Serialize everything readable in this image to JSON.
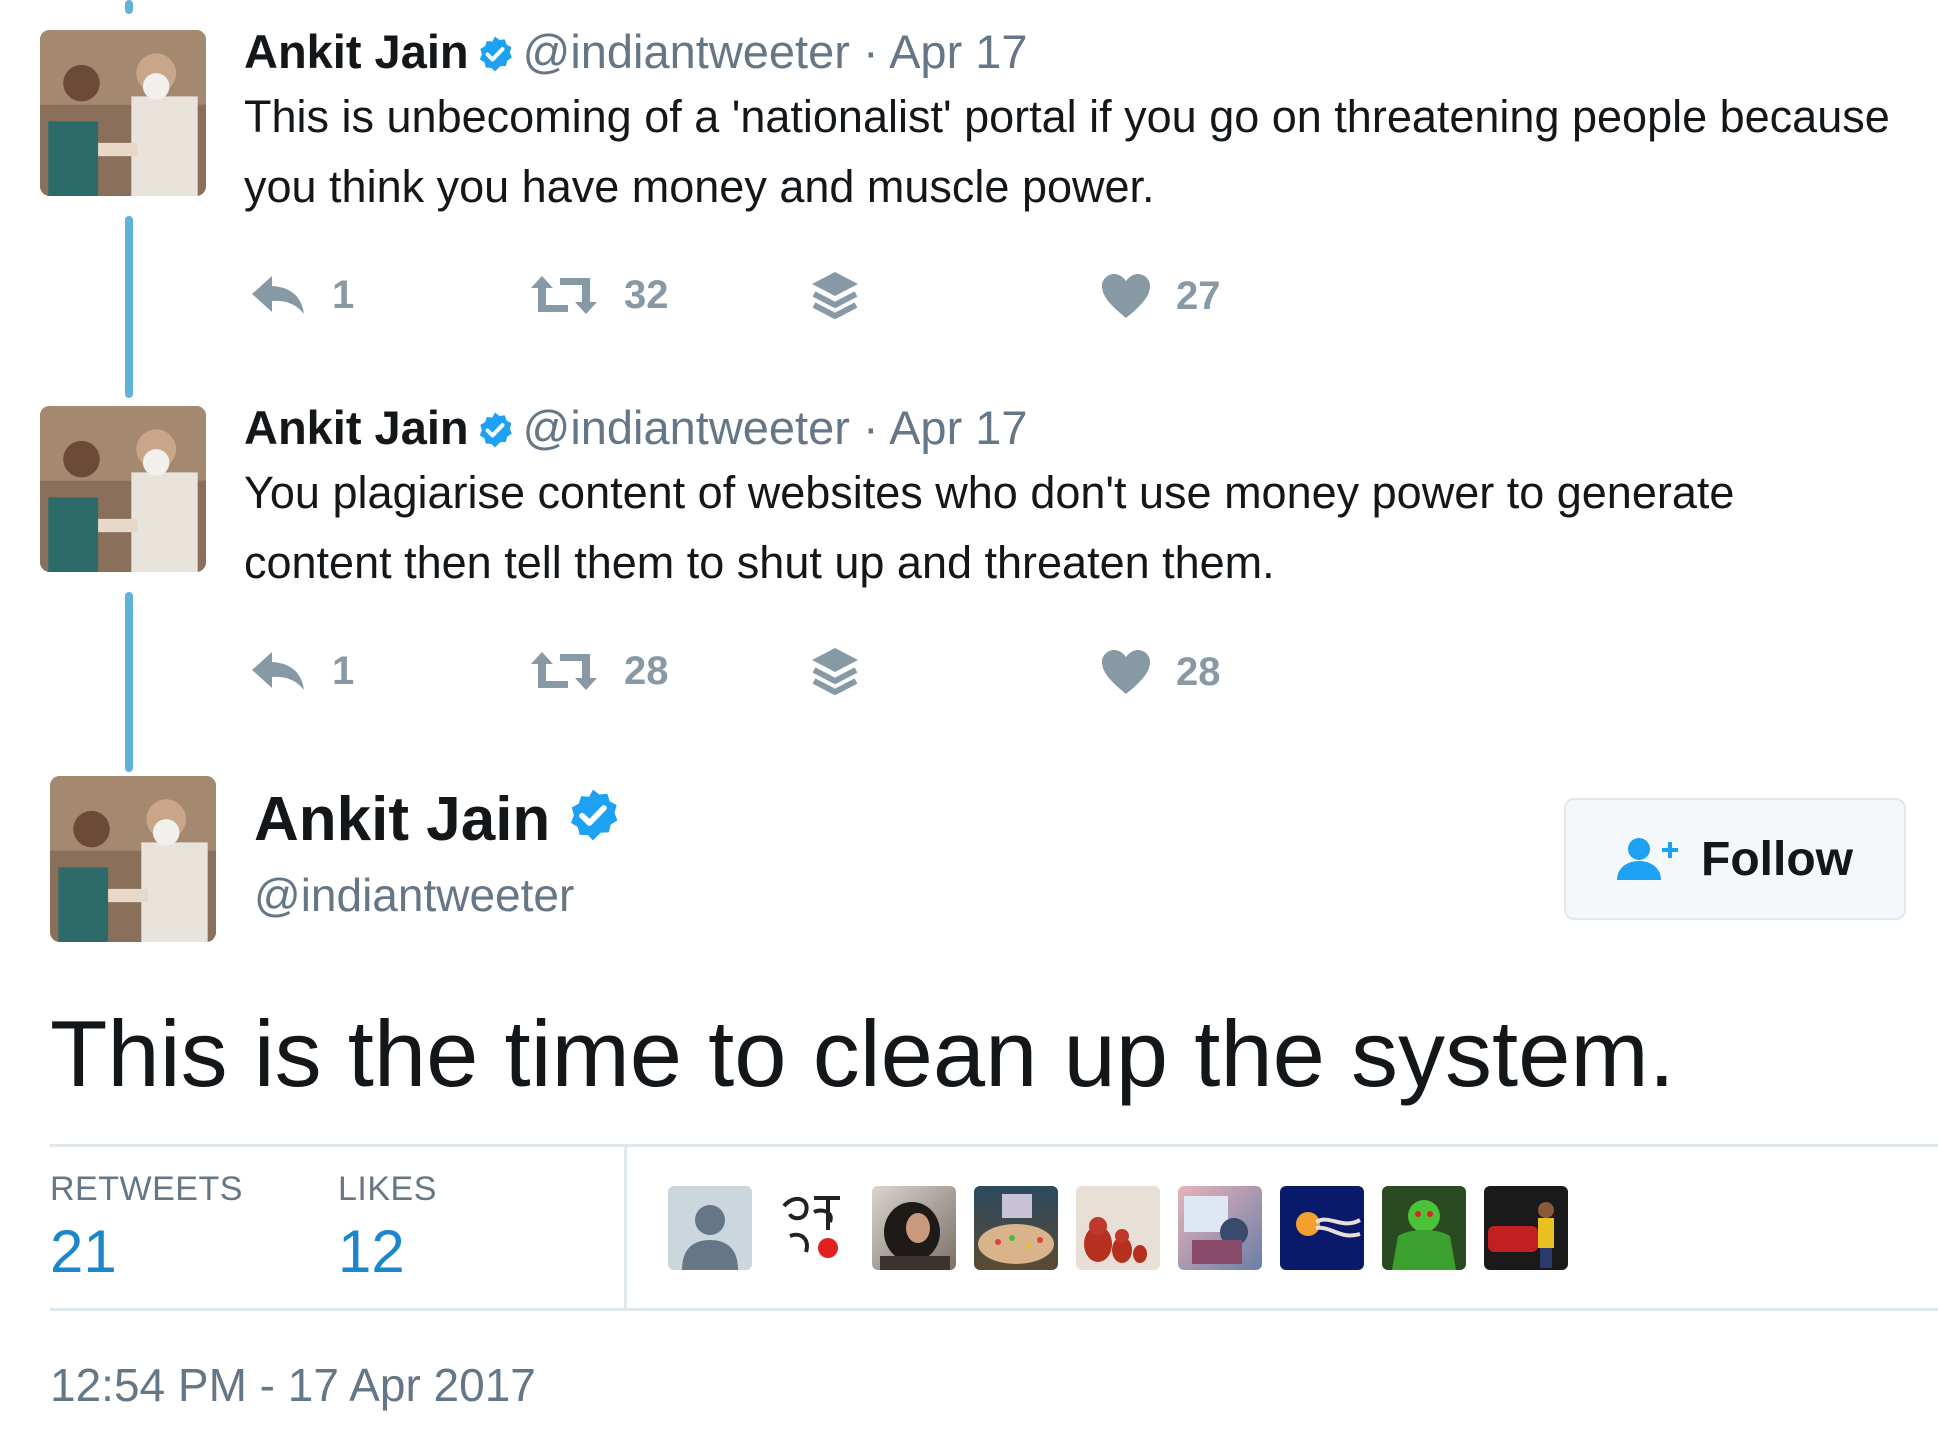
{
  "tweets": [
    {
      "name": "Ankit Jain",
      "handle": "@indiantweeter",
      "separator": "·",
      "date": "Apr 17",
      "text": "This is unbecoming of a 'nationalist' portal if you go on threatening people because you think you have money and muscle power.",
      "replies": "1",
      "retweets": "32",
      "likes": "27"
    },
    {
      "name": "Ankit Jain",
      "handle": "@indiantweeter",
      "separator": "·",
      "date": "Apr 17",
      "text": "You plagiarise content of websites who don't use money power to generate content then tell them to shut up and threaten them.",
      "replies": "1",
      "retweets": "28",
      "likes": "28"
    }
  ],
  "main_tweet": {
    "name": "Ankit Jain",
    "handle": "@indiantweeter",
    "follow_label": "Follow",
    "text": "This is the time to clean up the system.",
    "retweets_label": "RETWEETS",
    "retweets_count": "21",
    "likes_label": "LIKES",
    "likes_count": "12",
    "timestamp": "12:54 PM - 17 Apr 2017",
    "liker_count": 9
  },
  "colors": {
    "accent": "#1da1f2",
    "thread_line": "#5fb3d9",
    "stat_number": "#1b86c9",
    "secondary_text": "#657786",
    "action_icon": "#8899a6"
  },
  "icons": [
    "verified-badge-icon",
    "reply-icon",
    "retweet-icon",
    "layers-icon",
    "heart-icon",
    "follow-user-icon"
  ]
}
